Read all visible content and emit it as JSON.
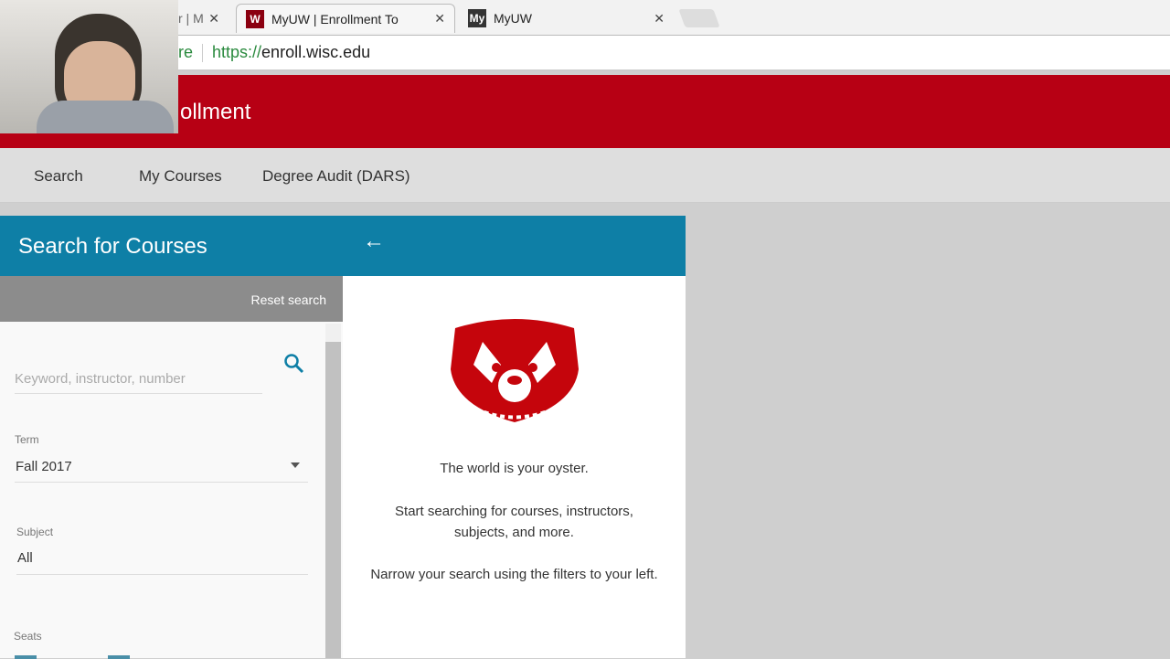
{
  "browser": {
    "tabs": [
      {
        "label": "r | M"
      },
      {
        "label": "MyUW | Enrollment To"
      },
      {
        "label": "MyUW"
      }
    ],
    "url_secure": "re",
    "url_scheme": "https://",
    "url_host": "enroll.wisc.edu"
  },
  "header": {
    "title": "ollment"
  },
  "nav": {
    "items": [
      "Search",
      "My Courses",
      "Degree Audit (DARS)"
    ]
  },
  "search": {
    "title": "Search for Courses",
    "reset": "Reset search",
    "keyword_placeholder": "Keyword, instructor, number",
    "term_label": "Term",
    "term_value": "Fall 2017",
    "subject_label": "Subject",
    "subject_value": "All",
    "seats_label": "Seats"
  },
  "results": {
    "msg1": "The world is your oyster.",
    "msg2": "Start searching for courses, instructors, subjects, and more.",
    "msg3": "Narrow your search using the filters to your left."
  },
  "colors": {
    "brand": "#b70014",
    "accent": "#0e7fa6"
  }
}
